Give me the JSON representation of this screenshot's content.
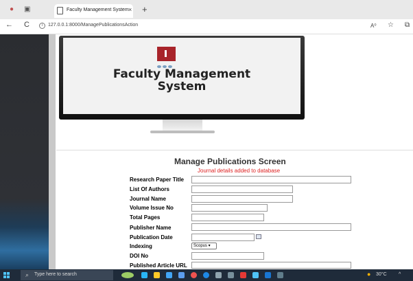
{
  "browser": {
    "tab_title": "Faculty Management System",
    "tab_close": "×",
    "new_tab": "+",
    "url": "127.0.0.1:8000/ManagePublicationsAction",
    "info_icon": "i",
    "back": "←",
    "refresh": "C",
    "reader": "A⁰",
    "favorite": "☆",
    "collections": "⧉"
  },
  "banner": {
    "title_line1": "Faculty Management",
    "title_line2": "System"
  },
  "form": {
    "heading": "Manage Publications Screen",
    "message": "Journal details added to database",
    "labels": {
      "research_paper_title": "Research Paper Title",
      "list_of_authors": "List Of Authors",
      "journal_name": "Journal Name",
      "volume_issue_no": "Volume Issue No",
      "total_pages": "Total Pages",
      "publisher_name": "Publisher Name",
      "publication_date": "Publication Date",
      "indexing": "Indexing",
      "doi_no": "DOI No",
      "published_article_url": "Published Article URL"
    },
    "indexing_selected": "Scopus ▾"
  },
  "taskbar": {
    "search_placeholder": "Type here to search",
    "search_icon": "⌕",
    "weather": "30°C",
    "tray_chevron": "^"
  },
  "colors": {
    "message": "#dd2222",
    "taskbar": "#1f2b3a",
    "logo": "#a8242a"
  }
}
